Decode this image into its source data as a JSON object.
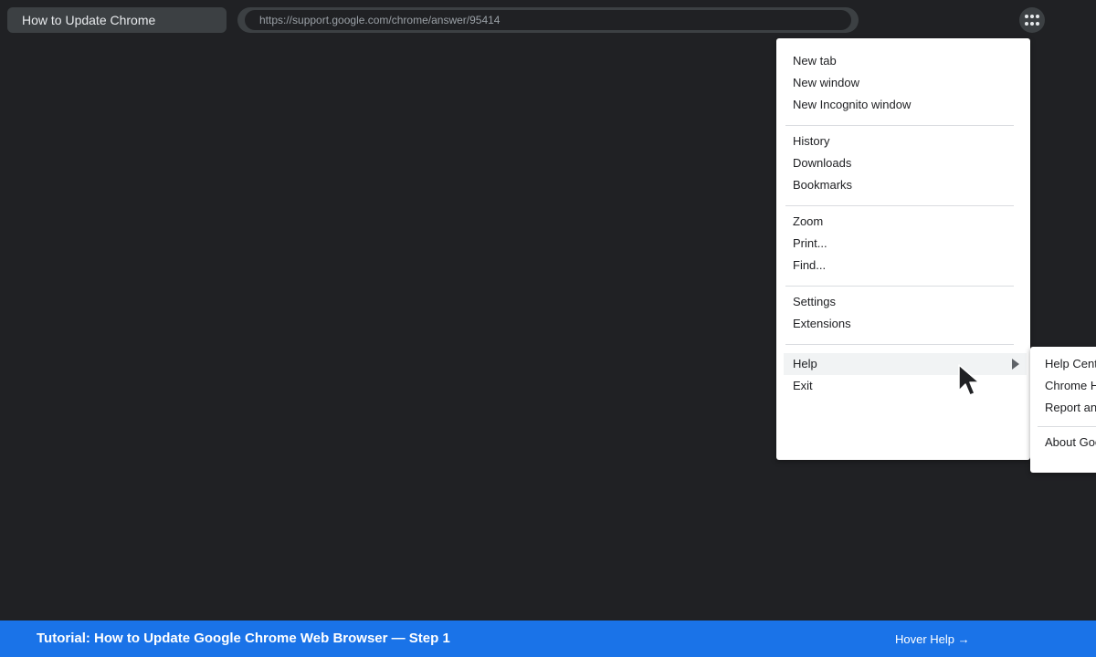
{
  "browser": {
    "tab_title": "How to Update Chrome",
    "address_bar": {
      "url": "https://support.google.com/chrome/answer/95414"
    },
    "menu_button_icon": "more-options-dots-icon"
  },
  "main_menu": {
    "items": [
      {
        "label": "New tab"
      },
      {
        "label": "New window"
      },
      {
        "label": "New Incognito window"
      },
      {
        "label": "History"
      },
      {
        "label": "Downloads"
      },
      {
        "label": "Bookmarks"
      },
      {
        "label": "Zoom"
      },
      {
        "label": "Print..."
      },
      {
        "label": "Find..."
      },
      {
        "label": "Settings"
      },
      {
        "label": "Extensions"
      },
      {
        "label": "Help",
        "hovered": true,
        "has_submenu": true
      },
      {
        "label": "Exit"
      }
    ]
  },
  "help_submenu": {
    "items": [
      {
        "label": "Help Cent"
      },
      {
        "label": "Chrome H"
      },
      {
        "label": "Report an"
      },
      {
        "label": "About Goo"
      }
    ]
  },
  "cursor": {
    "icon": "mouse-pointer-icon"
  },
  "tutorial_bar": {
    "title": "Tutorial: How to Update Google Chrome Web Browser — Step 1",
    "next_hint": "Hover Help →"
  },
  "colors": {
    "background": "#202124",
    "chrome_surface": "#3c4043",
    "menu_background": "#ffffff",
    "menu_hover": "#f1f3f4",
    "accent_bar": "#1a73e8"
  }
}
